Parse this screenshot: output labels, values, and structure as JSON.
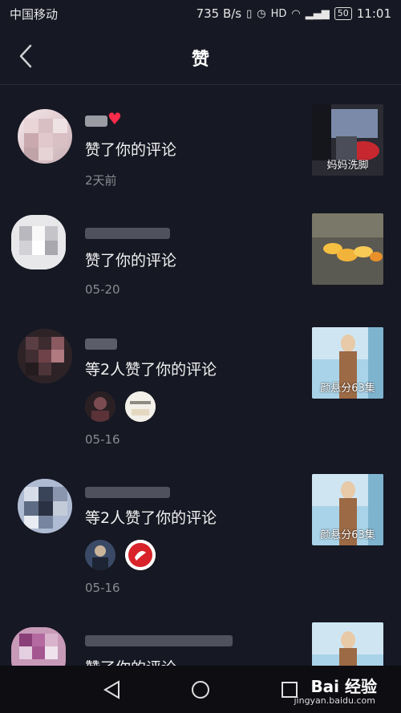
{
  "status": {
    "carrier": "中国移动",
    "speed": "735 B/s",
    "battery": "50",
    "time": "11:01"
  },
  "header": {
    "title": "赞"
  },
  "notifications": [
    {
      "action": "赞了你的评论",
      "date": "2天前",
      "thumb_caption": "妈妈洗脚"
    },
    {
      "action": "赞了你的评论",
      "date": "05-20",
      "thumb_caption": ""
    },
    {
      "action": "等2人赞了你的评论",
      "date": "05-16",
      "thumb_caption": "颜悬分63集"
    },
    {
      "action": "等2人赞了你的评论",
      "date": "05-16",
      "thumb_caption": "颜悬分63集"
    },
    {
      "action": "赞了你的评论",
      "date": "",
      "thumb_caption": ""
    }
  ],
  "watermark": {
    "brand": "Bai 经验",
    "url": "jingyan.baidu.com"
  },
  "colors": {
    "background": "#161823",
    "heart": "#ff2b4a",
    "secondary_text": "#8a8b91"
  }
}
